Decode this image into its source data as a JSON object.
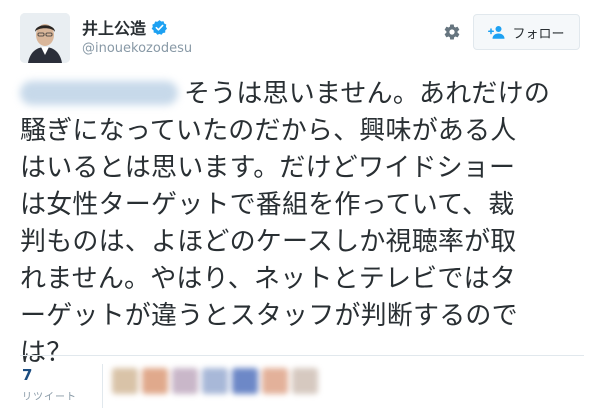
{
  "author": {
    "name": "井上公造",
    "handle": "@inouekozodesu",
    "verified": true
  },
  "actions": {
    "settings_icon": "gear-icon",
    "follow_icon": "person-add-icon",
    "follow_label": "フォロー"
  },
  "tweet": {
    "lines": [
      "そうは思いません。あれだけの",
      "騒ぎになっていたのだから、興味がある人",
      "はいるとは思います。だけどワイドショー",
      "は女性ターゲットで番組を作っていて、裁",
      "判ものは、よほどのケースしか視聴率が取",
      "れません。やはり、ネットとテレビではタ",
      "ーゲットが違うとスタッフが判断するので",
      "は？"
    ]
  },
  "stats": {
    "retweet_count": "7",
    "retweet_label": "リツイート"
  },
  "colors": {
    "text": "#292f33",
    "muted": "#8899a6",
    "verified": "#1da1f2",
    "count": "#1b4c80",
    "border": "#e1e8ed"
  }
}
